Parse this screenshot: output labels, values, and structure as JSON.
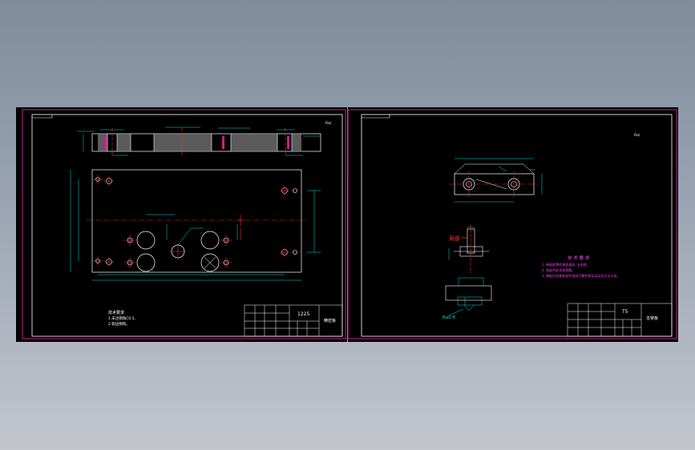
{
  "colors": {
    "background_top": "#7f8c9c",
    "background_bottom": "#c3c6cd",
    "sheet": "#000000",
    "sheet_border": "#c8208a",
    "frame": "#ffffff",
    "dimension": "#00e0e0",
    "centerline": "#ff2a2a",
    "hatch": "#7a7a7a",
    "tech_text": "#ff40ff"
  },
  "sheet_left": {
    "scale_mark": "Ra/ ",
    "notes_title": "技术要求",
    "notes_line1": "1.未注倒角C0.5,",
    "notes_line2": "2.锐边倒钝。",
    "title_block": {
      "code": "1225",
      "part_name": "精密板"
    }
  },
  "sheet_right": {
    "scale_mark": "Ra/ ",
    "surface_finish_label": "Ra0.8",
    "callout_red": "局部",
    "tech_req": {
      "title": "技 术 要 求",
      "line1": "1. 装配前零件表面清洗, 去毛刺。",
      "line2": "2. 各配合处涂润滑脂。",
      "line3": "3. 装配后检查各部件连接可靠并保证运动灵活无卡滞。"
    },
    "title_block": {
      "code": "T5",
      "part_name": "支架板"
    }
  }
}
